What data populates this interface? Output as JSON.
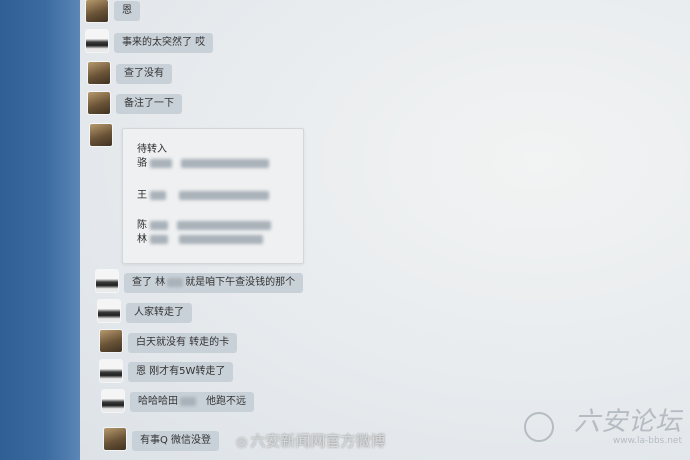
{
  "messages": [
    {
      "text": "恩"
    },
    {
      "text": "事来的太突然了 哎"
    },
    {
      "text": "查了没有"
    },
    {
      "text": "备注了一下"
    },
    {
      "text": "查了 林"
    },
    {
      "text": "人家转走了"
    },
    {
      "text": "白天就没有  转走的卡"
    },
    {
      "text": "恩  刚才有5W转走了"
    },
    {
      "text": "哈哈哈田"
    },
    {
      "text": "有事Q 微信没登"
    }
  ],
  "msg5_suffix": "就是咱下午查没钱的那个",
  "msg9_suffix": "他跑不远",
  "card": {
    "title": "待转入",
    "entry1": "骆",
    "entry2": "王",
    "entry3": "陈",
    "entry4": "林"
  },
  "watermarks": {
    "weibo": "六安新闻网官方微博",
    "logo_url": "www.la-bbs.net"
  }
}
